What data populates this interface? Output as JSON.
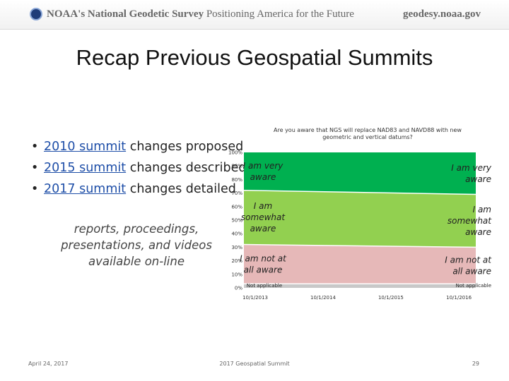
{
  "banner": {
    "left_bold": "NOAA's National Geodetic Survey",
    "left_rest": " Positioning America for the Future",
    "right": "geodesy.noaa.gov"
  },
  "slide": {
    "title": "Recap Previous Geospatial Summits",
    "bullets": [
      {
        "link": "2010 summit",
        "rest": " changes proposed"
      },
      {
        "link": "2015 summit",
        "rest": " changes described"
      },
      {
        "link": "2017 summit",
        "rest": " changes detailed"
      }
    ],
    "note_lines": [
      "reports, proceedings,",
      "presentations, and videos",
      "available on-line"
    ]
  },
  "footer": {
    "date": "April 24, 2017",
    "center": "2017 Geospatial Summit",
    "page": "29"
  },
  "chart_data": {
    "type": "area",
    "title_lines": [
      "Are you aware that NGS will replace NAD83 and NAVD88 with new",
      "geometric and vertical datums?"
    ],
    "x": [
      "10/1/2013",
      "10/1/2014",
      "10/1/2015",
      "10/1/2016"
    ],
    "x_domain": [
      "2013-08-01",
      "2016-12-31"
    ],
    "ylim": [
      0,
      100
    ],
    "y_ticks": [
      "0%",
      "10%",
      "20%",
      "30%",
      "40%",
      "50%",
      "60%",
      "70%",
      "80%",
      "90%",
      "100%"
    ],
    "stacked_percent": true,
    "series": [
      {
        "name": "Not applicable",
        "values_start": 3,
        "values_end": 3,
        "color": "#c8c8c8"
      },
      {
        "name": "I am not at all aware",
        "values_start": 29,
        "values_end": 27,
        "color": "#e6b8b8"
      },
      {
        "name": "I am somewhat aware",
        "values_start": 40,
        "values_end": 39,
        "color": "#92d050"
      },
      {
        "name": "I am very aware",
        "values_start": 28,
        "values_end": 31,
        "color": "#00b050"
      }
    ],
    "left_labels": [
      "Not applicable",
      "I am not at all aware",
      "I am somewhat aware",
      "I am very aware"
    ],
    "right_labels": [
      "Not applicable",
      "I am not at all aware",
      "I am somewhat aware",
      "I am very aware"
    ]
  }
}
